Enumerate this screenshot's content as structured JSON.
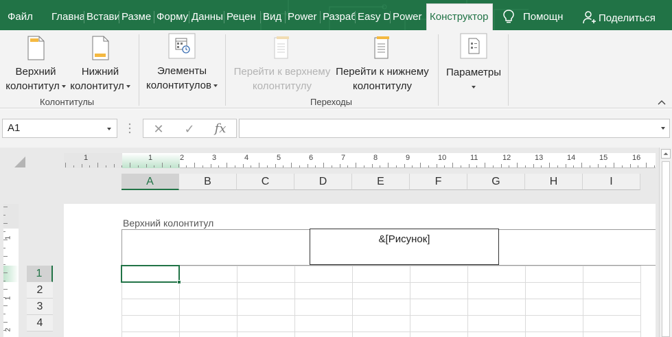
{
  "ribbon_tabs": [
    {
      "label": "Файл",
      "left": 0
    },
    {
      "label": "Главна"
    },
    {
      "label": "Встави"
    },
    {
      "label": "Разме"
    },
    {
      "label": "Форму"
    },
    {
      "label": "Данны"
    },
    {
      "label": "Рецен"
    },
    {
      "label": "Вид"
    },
    {
      "label": "Power"
    },
    {
      "label": "Разраб"
    },
    {
      "label": "Easy D"
    },
    {
      "label": "Power"
    },
    {
      "label": "Конструктор"
    }
  ],
  "help_label": "Помощн",
  "share_label": "Поделиться",
  "ribbon": {
    "header_btn": {
      "line1": "Верхний",
      "line2": "колонтитул"
    },
    "footer_btn": {
      "line1": "Нижний",
      "line2": "колонтитул"
    },
    "elements_btn": {
      "line1": "Элементы",
      "line2": "колонтитулов"
    },
    "goto_header_btn": {
      "line1": "Перейти к верхнему",
      "line2": "колонтитулу"
    },
    "goto_footer_btn": {
      "line1": "Перейти к нижнему",
      "line2": "колонтитулу"
    },
    "params_btn": {
      "line1": "Параметры"
    },
    "group_headers_footers": "Колонтитулы",
    "group_navigation": "Переходы"
  },
  "formula_bar": {
    "name_box": "A1",
    "cancel_glyph": "✕",
    "enter_glyph": "✓",
    "fx_glyph": "fx",
    "formula_value": ""
  },
  "ruler_h_numbers": [
    "1",
    "1",
    "2",
    "3",
    "4",
    "5",
    "6",
    "7",
    "8",
    "9",
    "10",
    "11",
    "12",
    "13",
    "14",
    "15",
    "16"
  ],
  "ruler_v_numbers": [
    "1",
    "1",
    "2"
  ],
  "columns": [
    "A",
    "B",
    "C",
    "D",
    "E",
    "F",
    "G",
    "H",
    "I"
  ],
  "rows": [
    "1",
    "2",
    "3",
    "4"
  ],
  "page": {
    "header_label": "Верхний колонтитул",
    "header_center_text": "&[Рисунок]"
  },
  "colors": {
    "accent": "#217346",
    "ribbon_bg": "#f3f3f3",
    "disabled_text": "#b3b3b3"
  }
}
